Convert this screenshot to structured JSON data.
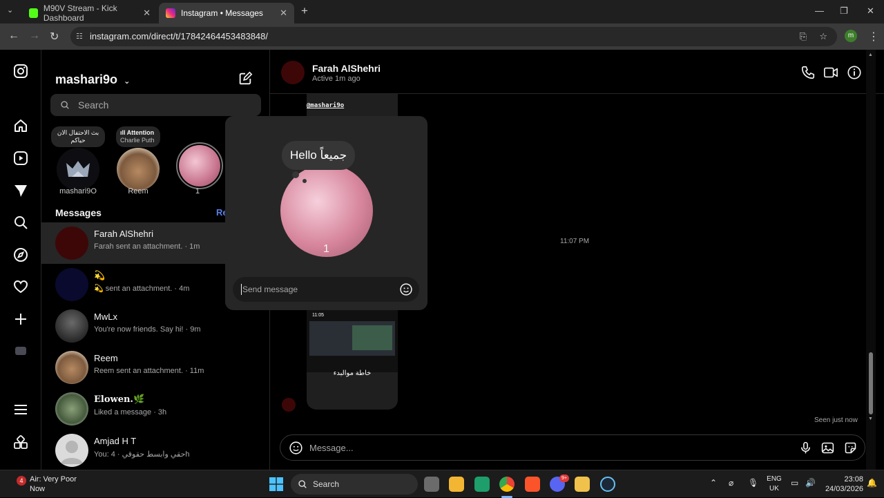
{
  "browser": {
    "tabs": [
      {
        "label": "M90V Stream - Kick Dashboard",
        "color": "#53fc18"
      },
      {
        "label": "Instagram • Messages",
        "color": "#e1306c"
      }
    ],
    "url": "instagram.com/direct/t/17842464453483848/",
    "profile_letter": "m"
  },
  "inbox": {
    "username": "mashari9o",
    "search_placeholder": "Search",
    "messages_title": "Messages",
    "requests_label": "Re",
    "notes": [
      {
        "bubble": "بث الاحتفال الان حياكم",
        "name": "mashari9O"
      },
      {
        "bubble_title": "Attention",
        "bubble_sub": "Charlie Puth",
        "name": "Reem"
      },
      {
        "name": "1"
      }
    ],
    "threads": [
      {
        "name": "Farah AlShehri",
        "sub": "Farah sent an attachment. · 1m"
      },
      {
        "name": "💫",
        "sub": "💫 sent an attachment. · 4m"
      },
      {
        "name": "MwLx",
        "sub": "You're now friends. Say hi! · 9m"
      },
      {
        "name": "Reem",
        "sub": "Reem sent an attachment. · 11m"
      },
      {
        "name": "Elowen.🌿",
        "sub": "Liked a message · 3h"
      },
      {
        "name": "Amjad H T",
        "sub": "You: حقي وابسط حقوقي · 4h"
      }
    ]
  },
  "conversation": {
    "name": "Farah AlShehri",
    "status": "Active 1m ago",
    "time_separator": "11:07 PM",
    "seen": "Seen just now",
    "composer_placeholder": "Message...",
    "attachment_mention": "@mashari9o",
    "screenshot_time": "11:05",
    "screenshot_caption": "خاطة موالبدء"
  },
  "popup": {
    "note_text": "Hello جميعاً",
    "name": "1",
    "send_placeholder": "Send message"
  },
  "taskbar": {
    "weather_title": "Air: Very Poor",
    "weather_sub": "Now",
    "search": "Search",
    "lang_1": "ENG",
    "lang_2": "UK",
    "time": "23:08",
    "date": "24/03/2026",
    "discord_badge": "9+"
  }
}
